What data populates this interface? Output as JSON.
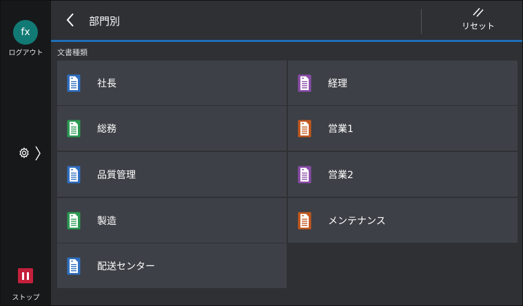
{
  "user": {
    "initials": "fx",
    "logout_label": "ログアウト"
  },
  "stop": {
    "label": "ストップ"
  },
  "header": {
    "title": "部門別",
    "reset_label": "リセット"
  },
  "section": {
    "label": "文書種類"
  },
  "colors": {
    "blue": "#2f6fc2",
    "purple": "#8a4ca8",
    "green": "#2b9a52",
    "orange": "#c4581e"
  },
  "items": [
    {
      "label": "社長",
      "color": "blue"
    },
    {
      "label": "経理",
      "color": "purple"
    },
    {
      "label": "総務",
      "color": "green"
    },
    {
      "label": "営業1",
      "color": "orange"
    },
    {
      "label": "品質管理",
      "color": "blue"
    },
    {
      "label": "営業2",
      "color": "purple"
    },
    {
      "label": "製造",
      "color": "green"
    },
    {
      "label": "メンテナンス",
      "color": "orange"
    },
    {
      "label": "配送センター",
      "color": "blue"
    }
  ]
}
